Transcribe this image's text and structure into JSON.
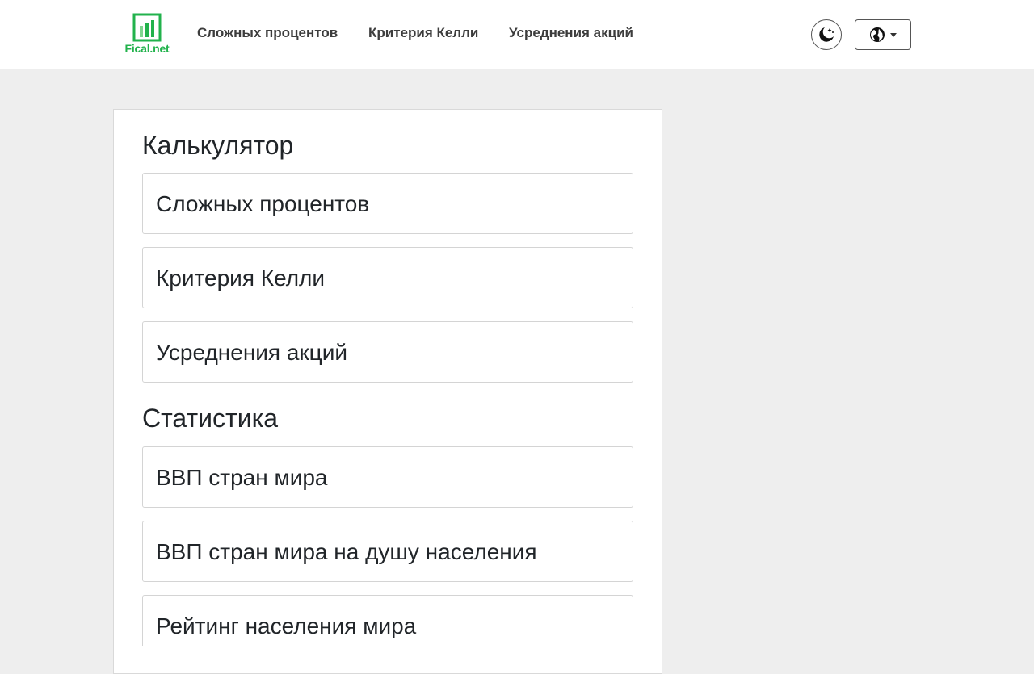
{
  "header": {
    "logo_text": "Fical.net",
    "nav": [
      {
        "label": "Сложных процентов"
      },
      {
        "label": "Критерия Келли"
      },
      {
        "label": "Усреднения акций"
      }
    ],
    "theme_icon": "moon-stars-icon",
    "language_icon": "globe-icon"
  },
  "colors": {
    "brand": "#22b24c",
    "background": "#eeeeee"
  },
  "main": {
    "sections": [
      {
        "title": "Калькулятор",
        "items": [
          {
            "label": "Сложных процентов"
          },
          {
            "label": "Критерия Келли"
          },
          {
            "label": "Усреднения акций"
          }
        ]
      },
      {
        "title": "Статистика",
        "items": [
          {
            "label": "ВВП стран мира"
          },
          {
            "label": "ВВП стран мира на душу населения"
          },
          {
            "label": "Рейтинг населения мира"
          }
        ]
      }
    ]
  }
}
